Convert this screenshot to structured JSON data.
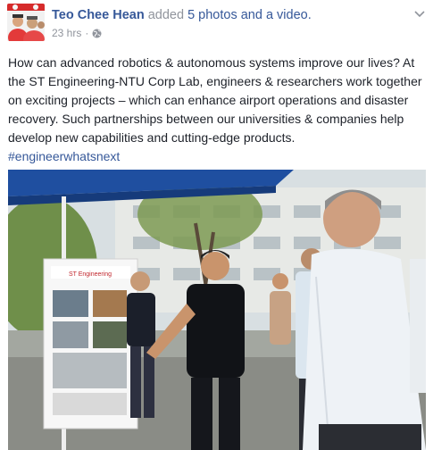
{
  "post": {
    "author": "Teo Chee Hean",
    "action_text": "added",
    "media_link": "5 photos and a video.",
    "timestamp": "23 hrs",
    "separator": "·",
    "privacy_icon": "globe-icon",
    "menu_icon": "chevron-down-icon",
    "text": "How can advanced robotics & autonomous systems improve our lives? At the ST Engineering-NTU Corp Lab, engineers & researchers work together on exciting projects – which can enhance airport operations and disaster recovery. Such partnerships between our universities & companies help develop new capabilities and cutting-edge products.",
    "hashtag": "#engineerwhatsnext",
    "photo": {
      "poster_brand": "ST Engineering"
    }
  },
  "colors": {
    "link": "#365899",
    "secondary_text": "#90949c",
    "body_text": "#1d2129",
    "tent": "#1f4fa0"
  }
}
